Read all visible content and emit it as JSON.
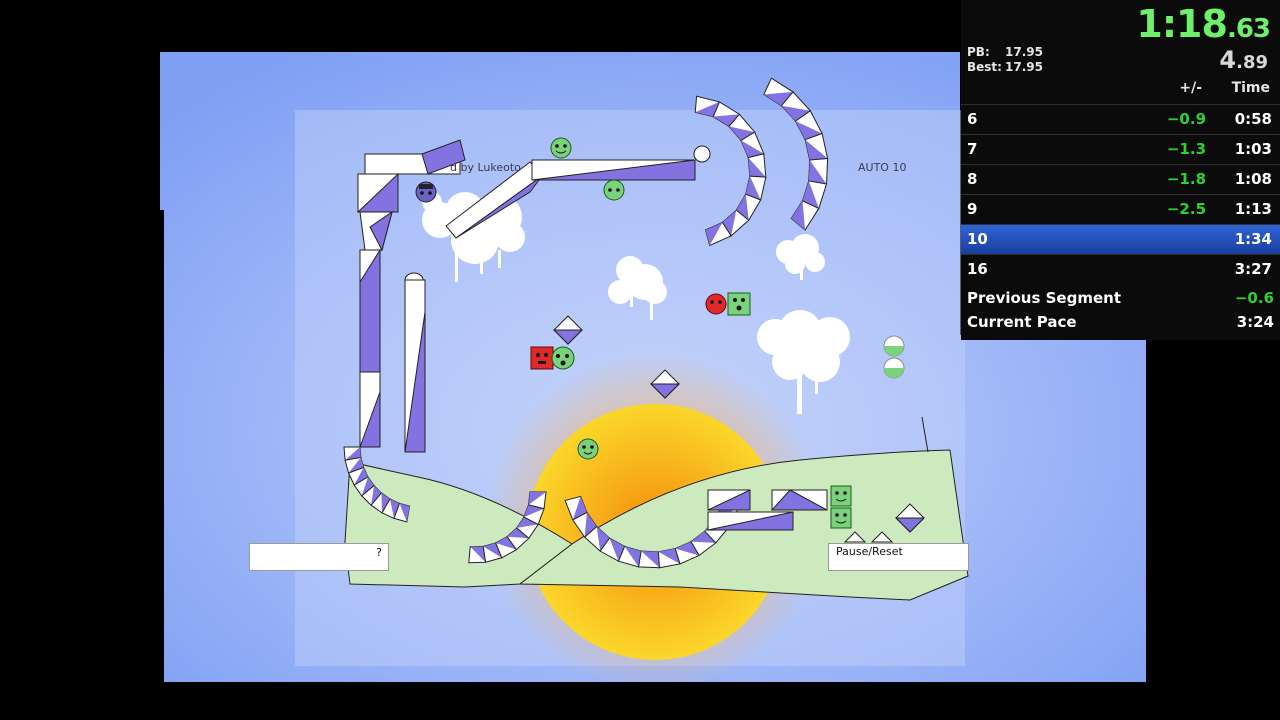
{
  "game": {
    "credit_text": "d by Lukeoto",
    "mode_label": "AUTO 10",
    "hint_box_text": "?",
    "pause_reset_label": "Pause/Reset"
  },
  "splits": {
    "timer_main": "1:18",
    "timer_main_cs": ".63",
    "timer_segment": "4",
    "timer_segment_cs": ".89",
    "pb_label": "PB:",
    "pb_value": "17.95",
    "best_label": "Best:",
    "best_value": "17.95",
    "col_delta": "+/-",
    "col_time": "Time",
    "rows": [
      {
        "name": "6",
        "delta": "−0.9",
        "time": "0:58"
      },
      {
        "name": "7",
        "delta": "−1.3",
        "time": "1:03"
      },
      {
        "name": "8",
        "delta": "−1.8",
        "time": "1:08"
      },
      {
        "name": "9",
        "delta": "−2.5",
        "time": "1:13"
      },
      {
        "name": "10",
        "delta": "",
        "time": "1:34"
      },
      {
        "name": "16",
        "delta": "",
        "time": "3:27"
      }
    ],
    "current_row_index": 4,
    "previous_segment_label": "Previous Segment",
    "previous_segment_value": "−0.6",
    "current_pace_label": "Current Pace",
    "current_pace_value": "3:24"
  },
  "colors": {
    "sky": "#8aa8f5",
    "grass": "#cdeabf",
    "sun": "#f7b21c",
    "block_purple": "#8373e0",
    "delta_green": "#2fd12f",
    "timer_green": "#6ef06a",
    "current_split_blue": "#2f64d6"
  }
}
